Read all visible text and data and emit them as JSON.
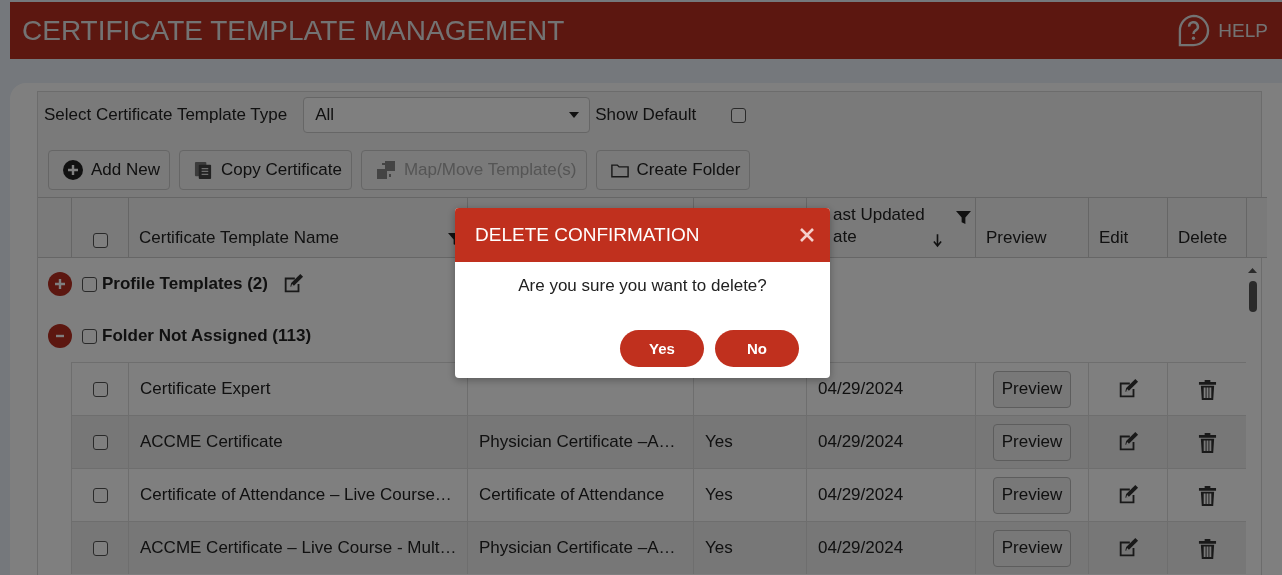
{
  "page": {
    "title": "CERTIFICATE TEMPLATE MANAGEMENT",
    "help": "HELP"
  },
  "filters": {
    "type_label": "Select Certificate Template Type",
    "type_value": "All",
    "show_default_label": "Show Default",
    "show_default_checked": false
  },
  "toolbar": [
    {
      "label": "Add New",
      "kind": "add",
      "disabled": false
    },
    {
      "label": "Copy Certificate",
      "kind": "copy",
      "disabled": false
    },
    {
      "label": "Map/Move Template(s)",
      "kind": "map",
      "disabled": true
    },
    {
      "label": "Create Folder",
      "kind": "folder",
      "disabled": false
    }
  ],
  "table": {
    "select_all_checked": false,
    "header": {
      "name_column": {
        "label": "Certificate Template Name",
        "filter": true
      },
      "updated_column": {
        "lines": [
          "ast Updated",
          "ate"
        ],
        "filter": true
      },
      "preview_column": {
        "label": "Preview"
      },
      "edit_column": {
        "label": "Edit"
      },
      "delete_column": {
        "label": "Delete"
      }
    },
    "groups": [
      {
        "name": "Profile Templates (2)",
        "expanded": false,
        "checked": false,
        "editable": true
      },
      {
        "name": "Folder Not Assigned (113)",
        "expanded": true,
        "checked": false,
        "editable": false,
        "rows": [
          {
            "checked": false,
            "name": "Certificate Expert",
            "updated": "04/29/2024",
            "preview": "Preview"
          },
          {
            "checked": false,
            "name": "ACCME Certificate",
            "type": "Physician Certificate –A…",
            "default": "Yes",
            "updated": "04/29/2024",
            "preview": "Preview"
          },
          {
            "checked": false,
            "name": "Certificate of Attendance – Live Course…",
            "type": "Certificate of Attendance",
            "default": "Yes",
            "updated": "04/29/2024",
            "preview": "Preview"
          },
          {
            "checked": false,
            "name": "ACCME Certificate – Live Course - Mult…",
            "type": "Physician Certificate –A…",
            "default": "Yes",
            "updated": "04/29/2024",
            "preview": "Preview"
          }
        ]
      }
    ]
  },
  "dialog": {
    "title": "DELETE CONFIRMATION",
    "message": "Are you sure you want to delete?",
    "buttons": [
      "Yes",
      "No"
    ]
  }
}
